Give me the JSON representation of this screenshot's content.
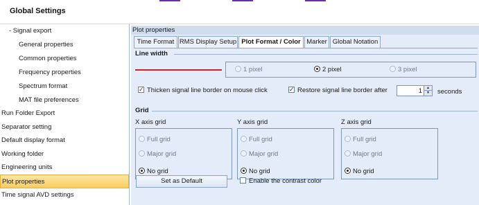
{
  "window": {
    "title": "Global Settings"
  },
  "sidebar": {
    "items": [
      {
        "label": "- Signal export",
        "level": 1
      },
      {
        "label": "General properties",
        "level": 2
      },
      {
        "label": "Common properties",
        "level": 2
      },
      {
        "label": "Frequency properties",
        "level": 2
      },
      {
        "label": "Spectrum format",
        "level": 2
      },
      {
        "label": "MAT file preferences",
        "level": 2
      },
      {
        "label": "Run Folder Export",
        "level": 0
      },
      {
        "label": "Separator setting",
        "level": 0
      },
      {
        "label": "Default display format",
        "level": 0
      },
      {
        "label": "Working folder",
        "level": 0
      },
      {
        "label": "Engineering units",
        "level": 0
      },
      {
        "label": "Plot properties",
        "level": 0,
        "selected": true
      },
      {
        "label": "Time signal AVD settings",
        "level": 0
      }
    ]
  },
  "panel": {
    "header": "Plot properties",
    "tabs": [
      {
        "label": "Time Format"
      },
      {
        "label": "RMS Display Setup"
      },
      {
        "label": "Plot Format / Color",
        "active": true
      },
      {
        "label": "Marker"
      },
      {
        "label": "Global Notation"
      }
    ],
    "line_width": {
      "label": "Line width",
      "line_color": "#d61f1f",
      "options": [
        {
          "label": "1 pixel",
          "checked": false
        },
        {
          "label": "2 pixel",
          "checked": true
        },
        {
          "label": "3 pixel",
          "checked": false
        }
      ]
    },
    "thicken_label": "Thicken signal line border on mouse click",
    "thicken_checked": true,
    "restore_label": "Restore signal line border after",
    "restore_checked": true,
    "restore_value": "1",
    "restore_unit": "seconds",
    "grid": {
      "label": "Grid",
      "axes": [
        {
          "title": "X axis grid",
          "options": [
            {
              "label": "Full grid",
              "checked": false
            },
            {
              "label": "Major grid",
              "checked": false
            },
            {
              "label": "No grid",
              "checked": true
            }
          ]
        },
        {
          "title": "Y axis grid",
          "options": [
            {
              "label": "Full grid",
              "checked": false
            },
            {
              "label": "Major grid",
              "checked": false
            },
            {
              "label": "No grid",
              "checked": true
            }
          ]
        },
        {
          "title": "Z axis grid",
          "options": [
            {
              "label": "Full grid",
              "checked": false
            },
            {
              "label": "Major grid",
              "checked": false
            },
            {
              "label": "No grid",
              "checked": true
            }
          ]
        }
      ]
    },
    "set_default_label": "Set as Default",
    "contrast_label": "Enable the contrast color",
    "contrast_checked": false
  },
  "colors": {
    "selected_item": "#fbcc5c",
    "panel_bg": "#e3ecf8",
    "accent_line": "#6b2fa0"
  }
}
